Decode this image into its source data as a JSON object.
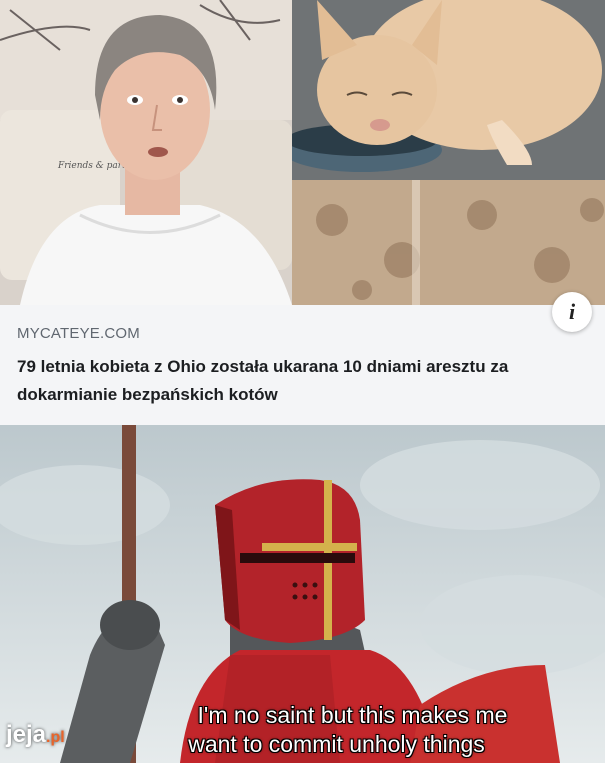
{
  "article_card": {
    "source": "MYCATEYE.COM",
    "headline": "79 letnia kobieta z Ohio została ukarana 10 dniami aresztu za dokarmianie bezpańskich kotów",
    "info_icon": "info-icon",
    "info_glyph": "i"
  },
  "photos": {
    "left_card_text": "Friends & partners"
  },
  "meme": {
    "caption_line1": "I'm no saint but this makes me",
    "caption_line2": "want to commit unholy things"
  },
  "watermark": {
    "brand": "jeja",
    "tld": ".pl"
  },
  "colors": {
    "card_bg": "#f4f5f7",
    "source_text": "#606770",
    "headline_text": "#1c1e21",
    "knight_red": "#c3262b",
    "watermark_accent": "#e9642a"
  }
}
